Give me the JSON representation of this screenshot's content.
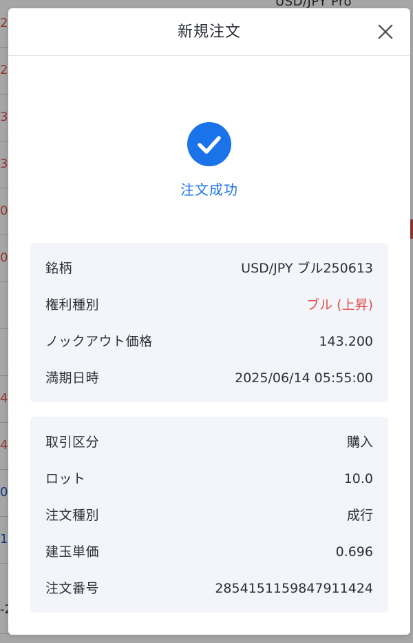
{
  "background": {
    "top_text": "USD/JPY Pro",
    "left_cells": [
      {
        "text": "2",
        "color": "#e0514a"
      },
      {
        "text": "2",
        "color": "#e0514a"
      },
      {
        "text": "3",
        "color": "#e0514a"
      },
      {
        "text": "3",
        "color": "#e0514a"
      },
      {
        "text": "0",
        "color": "#e0514a"
      },
      {
        "text": "0",
        "color": "#e0514a"
      },
      {
        "text": "",
        "color": "#2b2f36"
      },
      {
        "text": "",
        "color": "#2b2f36"
      },
      {
        "text": "4",
        "color": "#e0514a"
      },
      {
        "text": "4",
        "color": "#e0514a"
      },
      {
        "text": "0",
        "color": "#1a55c4"
      },
      {
        "text": "1",
        "color": "#1a55c4"
      },
      {
        "text": "-2",
        "color": "#2b2f36"
      }
    ]
  },
  "modal": {
    "title": "新規注文",
    "close_icon": "close-icon",
    "success": {
      "icon": "check-circle-icon",
      "label": "注文成功",
      "color": "#1a73e8"
    },
    "details": [
      {
        "label": "銘柄",
        "value": "USD/JPY ブル250613"
      },
      {
        "label": "権利種別",
        "value": "ブル (上昇)",
        "color": "#e0514a"
      },
      {
        "label": "ノックアウト価格",
        "value": "143.200"
      },
      {
        "label": "満期日時",
        "value": "2025/06/14 05:55:00"
      }
    ],
    "order": [
      {
        "label": "取引区分",
        "value": "購入"
      },
      {
        "label": "ロット",
        "value": "10.0"
      },
      {
        "label": "注文種別",
        "value": "成行"
      },
      {
        "label": "建玉単価",
        "value": "0.696"
      },
      {
        "label": "注文番号",
        "value": "2854151159847911424"
      }
    ]
  }
}
